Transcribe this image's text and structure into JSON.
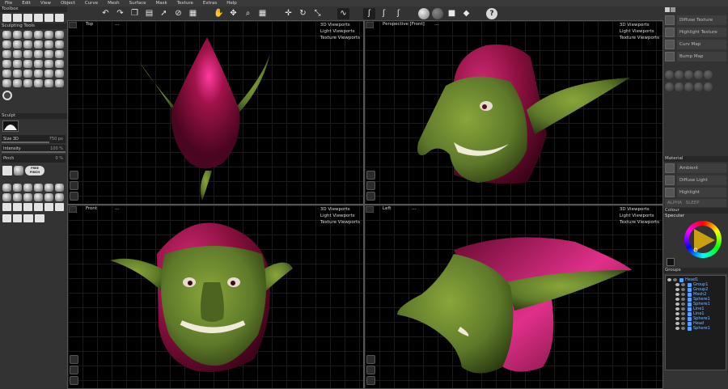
{
  "menu": [
    "File",
    "Edit",
    "View",
    "Object",
    "Curve",
    "Mesh",
    "Surface",
    "Mask",
    "Texture",
    "Extras",
    "Help"
  ],
  "toolbox": {
    "title": "Toolbox",
    "sculpting_title": "Sculpting Tools",
    "sculpt_title": "Sculpt",
    "size_label": "Size 3D",
    "size_value": "750 px",
    "size_fraction": 0.75,
    "intensity_label": "Intensity",
    "intensity_value": "100 %",
    "intensity_fraction": 1.0,
    "pinch_label": "Pinch",
    "pinch_value": "0 %",
    "pinch_fraction": 0.0,
    "free_pinch_line1": "FREE",
    "free_pinch_line2": "PINCH"
  },
  "viewports": [
    {
      "title": "Top",
      "dots": "...",
      "menu": [
        "3D Viewports",
        "Light Viewports",
        "Texture Viewports"
      ]
    },
    {
      "title": "Perspective [Front]",
      "dots": "...",
      "menu": [
        "3D Viewports",
        "Light Viewports",
        "Texture Viewports"
      ]
    },
    {
      "title": "Front",
      "dots": "...",
      "menu": [
        "3D Viewports",
        "Light Viewports",
        "Texture Viewports"
      ]
    },
    {
      "title": "Left",
      "dots": "...",
      "menu": [
        "3D Viewports",
        "Light Viewports",
        "Texture Viewports"
      ]
    }
  ],
  "right_panel": {
    "maps": [
      "Diffuse Texture",
      "Highlight Texture",
      "Curv Map",
      "Bump Map"
    ],
    "material_title": "Material",
    "material_items": [
      "Ambient",
      "Diffuse Light",
      "Highlight"
    ],
    "alpha_label": "ALPHA",
    "alpha_value": "SLEEP",
    "colour_title": "Colour",
    "specular_label": "Specular",
    "groups_title": "Groups",
    "groups": [
      "Head1",
      "Group1",
      "Group2",
      "Mesh2",
      "Sphere1",
      "Sphere1",
      "Line1",
      "Line1",
      "Sphere1",
      "Head",
      "Sphere1"
    ]
  },
  "colors": {
    "skin": "#5e7a2a",
    "hood": "#a0134a",
    "accent_blue": "#7fb6ff"
  }
}
